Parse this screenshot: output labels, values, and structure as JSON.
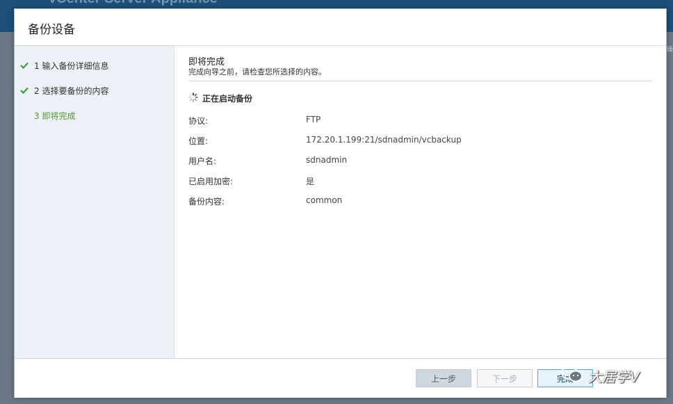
{
  "background": {
    "title": "vCenter Server Appliance",
    "right_text": "操"
  },
  "dialog": {
    "title": "备份设备"
  },
  "steps": [
    {
      "label": "1 输入备份详细信息",
      "status": "done"
    },
    {
      "label": "2 选择要备份的内容",
      "status": "done"
    },
    {
      "label": "3 即将完成",
      "status": "current"
    }
  ],
  "content": {
    "title": "即将完成",
    "subtitle": "完成向导之前，请检查您所选择的内容。",
    "status": "正在启动备份",
    "rows": [
      {
        "key": "协议:",
        "value": "FTP"
      },
      {
        "key": "位置:",
        "value": "172.20.1.199:21/sdnadmin/vcbackup"
      },
      {
        "key": "用户名:",
        "value": "sdnadmin"
      },
      {
        "key": "已启用加密:",
        "value": "是"
      },
      {
        "key": "备份内容:",
        "value": "common"
      }
    ]
  },
  "footer": {
    "back_label": "上一步",
    "next_label": "下一步",
    "finish_label": "完成"
  },
  "watermark": {
    "text": "大居学V",
    "icon": "wechat-icon"
  },
  "colors": {
    "check": "#3a9a3a",
    "current_step": "#4c9a2a",
    "accent_border": "#5fa6d6"
  }
}
